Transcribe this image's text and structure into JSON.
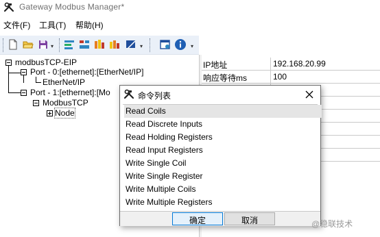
{
  "window": {
    "title": "Gateway Modbus Manager*",
    "icon": "hammer-wrench-icon"
  },
  "menu": [
    {
      "label": "文件(F)"
    },
    {
      "label": "工具(T)"
    },
    {
      "label": "帮助(H)"
    }
  ],
  "toolbar": {
    "buttons": [
      "new-file-icon",
      "open-folder-icon",
      "save-icon",
      "tool-icon-1",
      "tool-icon-2",
      "tool-icon-3",
      "tool-icon-4",
      "tool-icon-5",
      "window-icon",
      "info-icon"
    ]
  },
  "tree": {
    "root": "modbusTCP-EIP",
    "port0": "Port - 0:[ethernet]:[EtherNet/IP]",
    "port0_child": "EtherNet/IP",
    "port1": "Port - 1:[ethernet]:[Mo",
    "port1_child": "ModbusTCP",
    "node": "Node"
  },
  "properties": [
    {
      "key": "IP地址",
      "value": "192.168.20.99"
    },
    {
      "key": "响应等待ms",
      "value": "100"
    },
    {
      "key": "",
      "value": ""
    },
    {
      "key": "",
      "value": ""
    },
    {
      "key": "",
      "value": ""
    },
    {
      "key": "",
      "value": ""
    },
    {
      "key": "",
      "value": ""
    },
    {
      "key": "",
      "value": ""
    }
  ],
  "dialog": {
    "title": "命令列表",
    "close_label": "✕",
    "commands": [
      "Read Coils",
      "Read Discrete Inputs",
      "Read Holding Registers",
      "Read Input Registers",
      "Write Single Coil",
      "Write Single Register",
      "Write Multiple Coils",
      "Write Multiple Registers"
    ],
    "selected_index": 0,
    "ok_label": "确定",
    "cancel_label": "取消"
  },
  "watermark": "@稳联技术"
}
